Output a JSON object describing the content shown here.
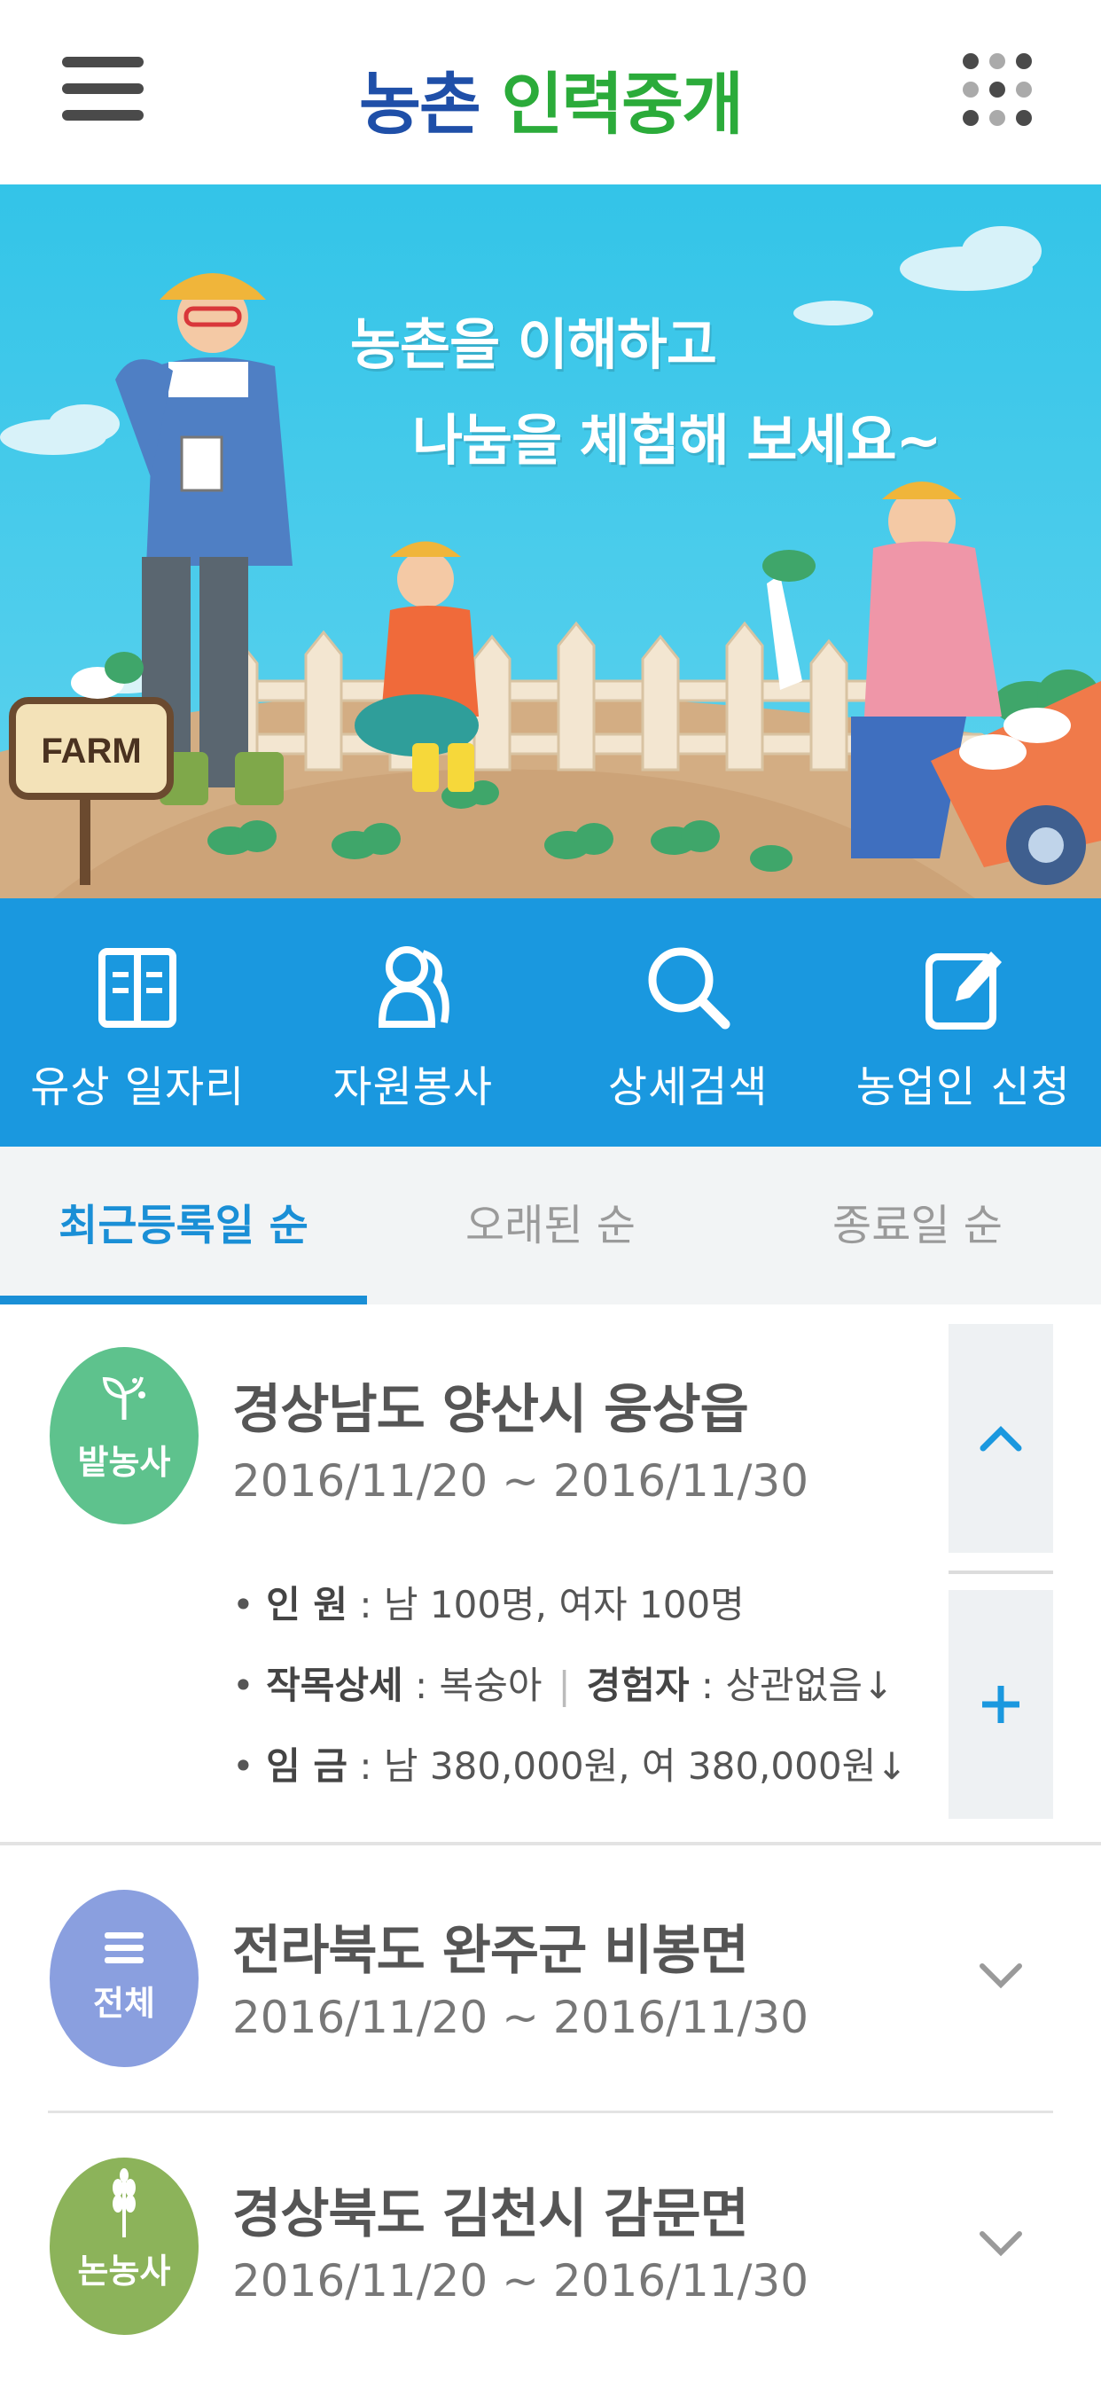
{
  "header": {
    "logo_part1": "농촌",
    "logo_part2": "인력중개",
    "menu_icon": "hamburger-menu-icon",
    "apps_icon": "grid-dots-icon"
  },
  "banner": {
    "line1": "농촌을 이해하고",
    "line2": "나눔을 체험해 보세요~",
    "sign_text": "FARM"
  },
  "quick_nav": [
    {
      "label": "유상 일자리",
      "icon": "book-icon"
    },
    {
      "label": "자원봉사",
      "icon": "people-icon"
    },
    {
      "label": "상세검색",
      "icon": "search-icon"
    },
    {
      "label": "농업인 신청",
      "icon": "edit-icon"
    }
  ],
  "tabs": [
    {
      "label": "최근등록일 순",
      "active": true
    },
    {
      "label": "오래된 순",
      "active": false
    },
    {
      "label": "종료일 순",
      "active": false
    }
  ],
  "entries": [
    {
      "badge": "밭농사",
      "badge_color": "#5ec28d",
      "title": "경상남도 양산시 웅상읍",
      "date": "2016/11/20 ~ 2016/11/30",
      "expanded": true,
      "details": {
        "people_label": "인 원",
        "people_value": ": 남 100명, 여자 100명",
        "crop_label": "작목상세",
        "crop_value": ": 복숭아",
        "exp_label": "경험자",
        "exp_value": ": 상관없음↓",
        "wage_label": "임 금",
        "wage_value": ": 남 380,000원, 여 380,000원↓"
      }
    },
    {
      "badge": "전체",
      "badge_color": "#8a9fdf",
      "title": "전라북도 완주군 비봉면",
      "date": "2016/11/20 ~ 2016/11/30",
      "expanded": false
    },
    {
      "badge": "논농사",
      "badge_color": "#8cb35a",
      "title": "경상북도 김천시 감문면",
      "date": "2016/11/20 ~ 2016/11/30",
      "expanded": false
    }
  ],
  "colors": {
    "accent": "#1a98df",
    "tab_active": "#1a8fd6",
    "logo_blue": "#1f4fa8",
    "logo_green": "#2bab3a"
  }
}
